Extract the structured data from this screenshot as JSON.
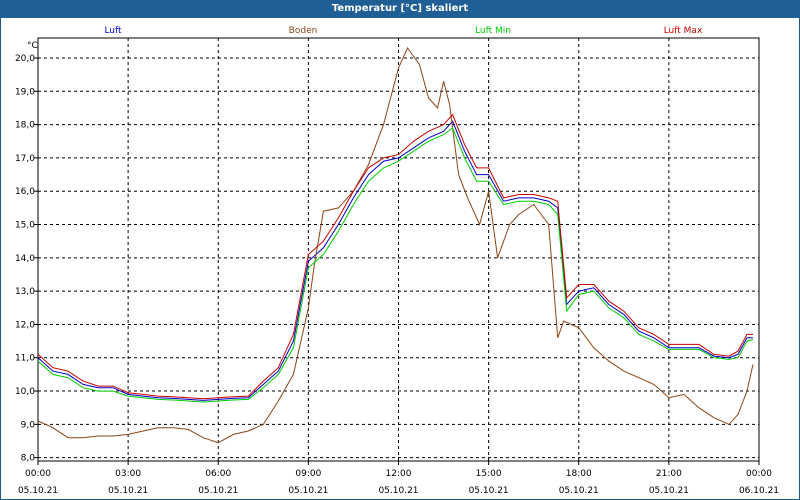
{
  "window": {
    "title": "Temperatur [°C] skaliert"
  },
  "chart_data": {
    "type": "line",
    "unit_label": "°C",
    "ylim": [
      7.9,
      20.6
    ],
    "y_ticks": [
      "8,0",
      "9,0",
      "10,0",
      "11,0",
      "12,0",
      "13,0",
      "14,0",
      "15,0",
      "16,0",
      "17,0",
      "18,0",
      "19,0",
      "20,0"
    ],
    "y_tick_values": [
      8,
      9,
      10,
      11,
      12,
      13,
      14,
      15,
      16,
      17,
      18,
      19,
      20
    ],
    "xlim": [
      0,
      24
    ],
    "x_tick_values": [
      0,
      3,
      6,
      9,
      12,
      15,
      18,
      21,
      24
    ],
    "x_ticks": [
      {
        "time": "00:00",
        "date": "05.10.21"
      },
      {
        "time": "03:00",
        "date": "05.10.21"
      },
      {
        "time": "06:00",
        "date": "05.10.21"
      },
      {
        "time": "09:00",
        "date": "05.10.21"
      },
      {
        "time": "12:00",
        "date": "05.10.21"
      },
      {
        "time": "15:00",
        "date": "05.10.21"
      },
      {
        "time": "18:00",
        "date": "05.10.21"
      },
      {
        "time": "21:00",
        "date": "05.10.21"
      },
      {
        "time": "00:00",
        "date": "06.10.21"
      }
    ],
    "grid": true,
    "legend_position": "top",
    "series": [
      {
        "name": "Luft",
        "color": "#0000cc",
        "x": [
          0,
          0.5,
          1,
          1.5,
          2,
          2.5,
          3,
          3.5,
          4,
          4.5,
          5,
          5.5,
          6,
          6.5,
          7,
          7.5,
          8,
          8.5,
          9,
          9.5,
          10,
          10.5,
          11,
          11.5,
          12,
          12.5,
          13,
          13.5,
          13.8,
          14.2,
          14.6,
          15,
          15.5,
          16,
          16.5,
          17,
          17.3,
          17.6,
          18,
          18.5,
          19,
          19.5,
          20,
          20.5,
          21,
          21.5,
          22,
          22.5,
          23,
          23.3,
          23.6,
          23.8
        ],
        "y": [
          11.0,
          10.6,
          10.5,
          10.2,
          10.1,
          10.1,
          9.9,
          9.85,
          9.8,
          9.78,
          9.75,
          9.72,
          9.75,
          9.78,
          9.8,
          10.2,
          10.6,
          11.5,
          13.9,
          14.3,
          15.0,
          15.8,
          16.5,
          16.9,
          17.0,
          17.3,
          17.6,
          17.8,
          18.1,
          17.2,
          16.5,
          16.5,
          15.7,
          15.8,
          15.8,
          15.7,
          15.5,
          12.6,
          13.0,
          13.1,
          12.6,
          12.3,
          11.8,
          11.6,
          11.3,
          11.3,
          11.3,
          11.05,
          11.0,
          11.1,
          11.6,
          11.6
        ]
      },
      {
        "name": "Boden",
        "color": "#8b4513",
        "x": [
          0,
          0.5,
          1,
          1.5,
          2,
          2.5,
          3,
          3.5,
          4,
          4.5,
          5,
          5.5,
          6,
          6.5,
          7,
          7.5,
          8,
          8.5,
          9,
          9.2,
          9.5,
          10,
          10.5,
          11,
          11.5,
          12,
          12.3,
          12.7,
          13,
          13.3,
          13.5,
          13.7,
          14,
          14.3,
          14.7,
          15,
          15.3,
          15.7,
          16,
          16.5,
          17,
          17.3,
          17.5,
          18,
          18.5,
          19,
          19.5,
          20,
          20.5,
          21,
          21.5,
          22,
          22.5,
          23,
          23.3,
          23.6,
          23.8
        ],
        "y": [
          9.1,
          8.9,
          8.6,
          8.6,
          8.65,
          8.65,
          8.7,
          8.8,
          8.9,
          8.9,
          8.85,
          8.6,
          8.45,
          8.7,
          8.8,
          9.0,
          9.7,
          10.5,
          12.5,
          13.8,
          15.4,
          15.5,
          16.0,
          16.8,
          18.0,
          19.7,
          20.3,
          19.8,
          18.8,
          18.5,
          19.3,
          18.6,
          16.5,
          15.8,
          15.0,
          16.0,
          14.0,
          15.0,
          15.3,
          15.6,
          15.0,
          11.6,
          12.1,
          11.9,
          11.3,
          10.9,
          10.6,
          10.4,
          10.2,
          9.8,
          9.9,
          9.5,
          9.2,
          9.0,
          9.3,
          10.0,
          10.8
        ]
      },
      {
        "name": "Luft Min",
        "color": "#00cc00",
        "x": [
          0,
          0.5,
          1,
          1.5,
          2,
          2.5,
          3,
          3.5,
          4,
          4.5,
          5,
          5.5,
          6,
          6.5,
          7,
          7.5,
          8,
          8.5,
          9,
          9.5,
          10,
          10.5,
          11,
          11.5,
          12,
          12.5,
          13,
          13.5,
          13.8,
          14.2,
          14.6,
          15,
          15.5,
          16,
          16.5,
          17,
          17.3,
          17.6,
          18,
          18.5,
          19,
          19.5,
          20,
          20.5,
          21,
          21.5,
          22,
          22.5,
          23,
          23.3,
          23.6,
          23.8
        ],
        "y": [
          10.9,
          10.5,
          10.4,
          10.1,
          10.0,
          10.0,
          9.85,
          9.8,
          9.75,
          9.73,
          9.7,
          9.67,
          9.7,
          9.73,
          9.75,
          10.1,
          10.5,
          11.3,
          13.7,
          14.1,
          14.8,
          15.6,
          16.3,
          16.7,
          16.9,
          17.2,
          17.5,
          17.7,
          17.9,
          17.0,
          16.3,
          16.3,
          15.6,
          15.7,
          15.7,
          15.6,
          15.3,
          12.4,
          12.9,
          13.0,
          12.5,
          12.2,
          11.7,
          11.5,
          11.25,
          11.25,
          11.25,
          11.0,
          10.95,
          11.0,
          11.5,
          11.55
        ]
      },
      {
        "name": "Luft Max",
        "color": "#cc0000",
        "x": [
          0,
          0.5,
          1,
          1.5,
          2,
          2.5,
          3,
          3.5,
          4,
          4.5,
          5,
          5.5,
          6,
          6.5,
          7,
          7.5,
          8,
          8.5,
          9,
          9.5,
          10,
          10.5,
          11,
          11.5,
          12,
          12.5,
          13,
          13.5,
          13.8,
          14.2,
          14.6,
          15,
          15.5,
          16,
          16.5,
          17,
          17.3,
          17.6,
          18,
          18.5,
          19,
          19.5,
          20,
          20.5,
          21,
          21.5,
          22,
          22.5,
          23,
          23.3,
          23.6,
          23.8
        ],
        "y": [
          11.1,
          10.7,
          10.6,
          10.3,
          10.15,
          10.15,
          9.95,
          9.9,
          9.85,
          9.83,
          9.8,
          9.77,
          9.8,
          9.83,
          9.85,
          10.3,
          10.7,
          11.7,
          14.1,
          14.5,
          15.2,
          16.0,
          16.7,
          17.0,
          17.1,
          17.5,
          17.8,
          18.0,
          18.3,
          17.4,
          16.7,
          16.7,
          15.8,
          15.9,
          15.9,
          15.8,
          15.7,
          12.8,
          13.2,
          13.2,
          12.7,
          12.4,
          11.9,
          11.7,
          11.4,
          11.4,
          11.4,
          11.1,
          11.05,
          11.2,
          11.7,
          11.7
        ]
      }
    ]
  }
}
